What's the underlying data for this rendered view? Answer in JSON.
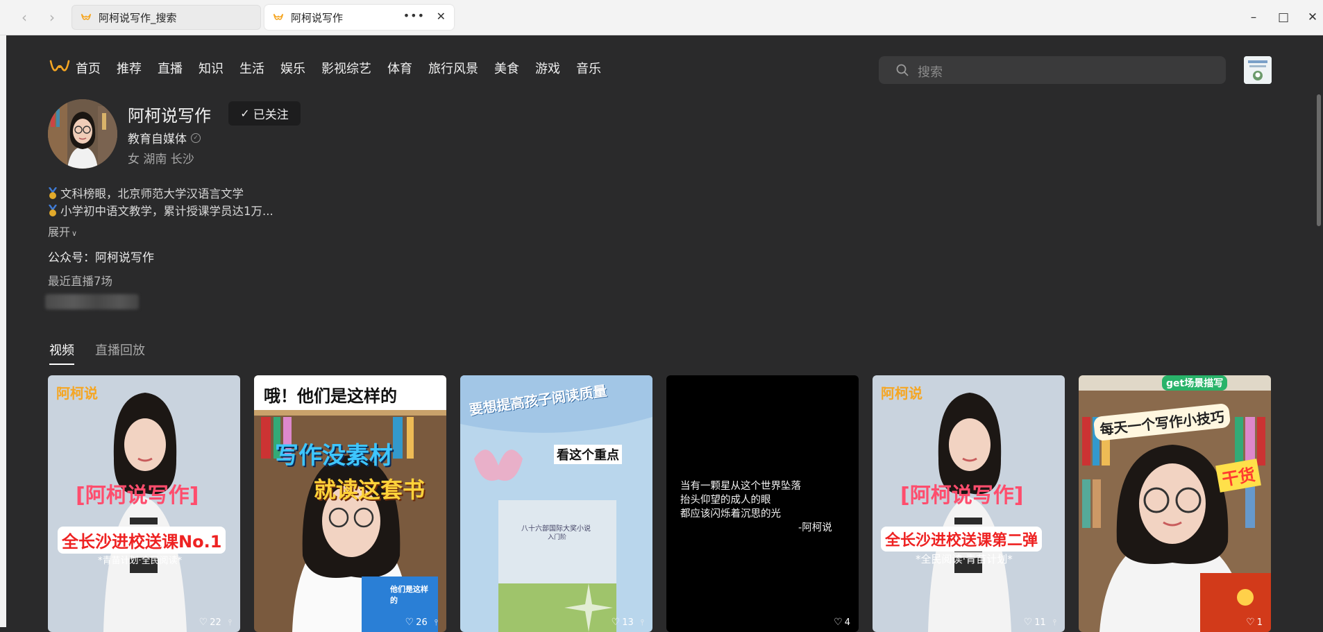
{
  "browser": {
    "tabs": [
      {
        "label": "阿柯说写作_搜索",
        "active": false
      },
      {
        "label": "阿柯说写作",
        "active": true
      }
    ]
  },
  "nav": {
    "items": [
      "首页",
      "推荐",
      "直播",
      "知识",
      "生活",
      "娱乐",
      "影视综艺",
      "体育",
      "旅行风景",
      "美食",
      "游戏",
      "音乐"
    ]
  },
  "search": {
    "placeholder": "搜索"
  },
  "profile": {
    "name": "阿柯说写作",
    "follow_label": "已关注",
    "certification": "教育自媒体",
    "location": "女 湖南 长沙",
    "bio_lines": [
      "文科榜眼，北京师范大学汉语言文学",
      "小学初中语文教学，累计授课学员达1万..."
    ],
    "expand_label": "展开",
    "gzh": "公众号：阿柯说写作",
    "recent_live": "最近直播7场"
  },
  "content_tabs": [
    {
      "label": "视频",
      "active": true
    },
    {
      "label": "直播回放",
      "active": false
    }
  ],
  "videos": [
    {
      "likes": "22",
      "title_big": "[阿柯说写作]",
      "sub": "全长沙进校送课No.1",
      "sub2": "*青苗计划·全民阅读*",
      "brand": "阿柯说"
    },
    {
      "likes": "26",
      "top": "哦！他们是这样的",
      "mid1": "写作没素材",
      "mid2": "就读这套书",
      "book": "他们是这样的"
    },
    {
      "likes": "13",
      "top": "要想提高孩子阅读质量",
      "note": "看这个重点",
      "book_title": "八十六部国际大奖小说",
      "book_sub": "入门阶"
    },
    {
      "likes": "4",
      "poem_lines": [
        "当有一颗星从这个世界坠落",
        "抬头仰望的成人的眼",
        "都应该闪烁着沉思的光",
        "-阿柯说"
      ]
    },
    {
      "likes": "11",
      "title_big": "[阿柯说写作]",
      "sub": "全长沙进校送课第二弹",
      "sub2": "*全民阅读·青苗计划*",
      "brand": "阿柯说"
    },
    {
      "likes": "1",
      "badge": "get场景描写",
      "top": "每天一个写作小技巧",
      "tag": "干货"
    }
  ],
  "colors": {
    "page_bg": "#2a2a2b",
    "brand_orange": "#f5a623",
    "card_red": "#e83a3a"
  }
}
